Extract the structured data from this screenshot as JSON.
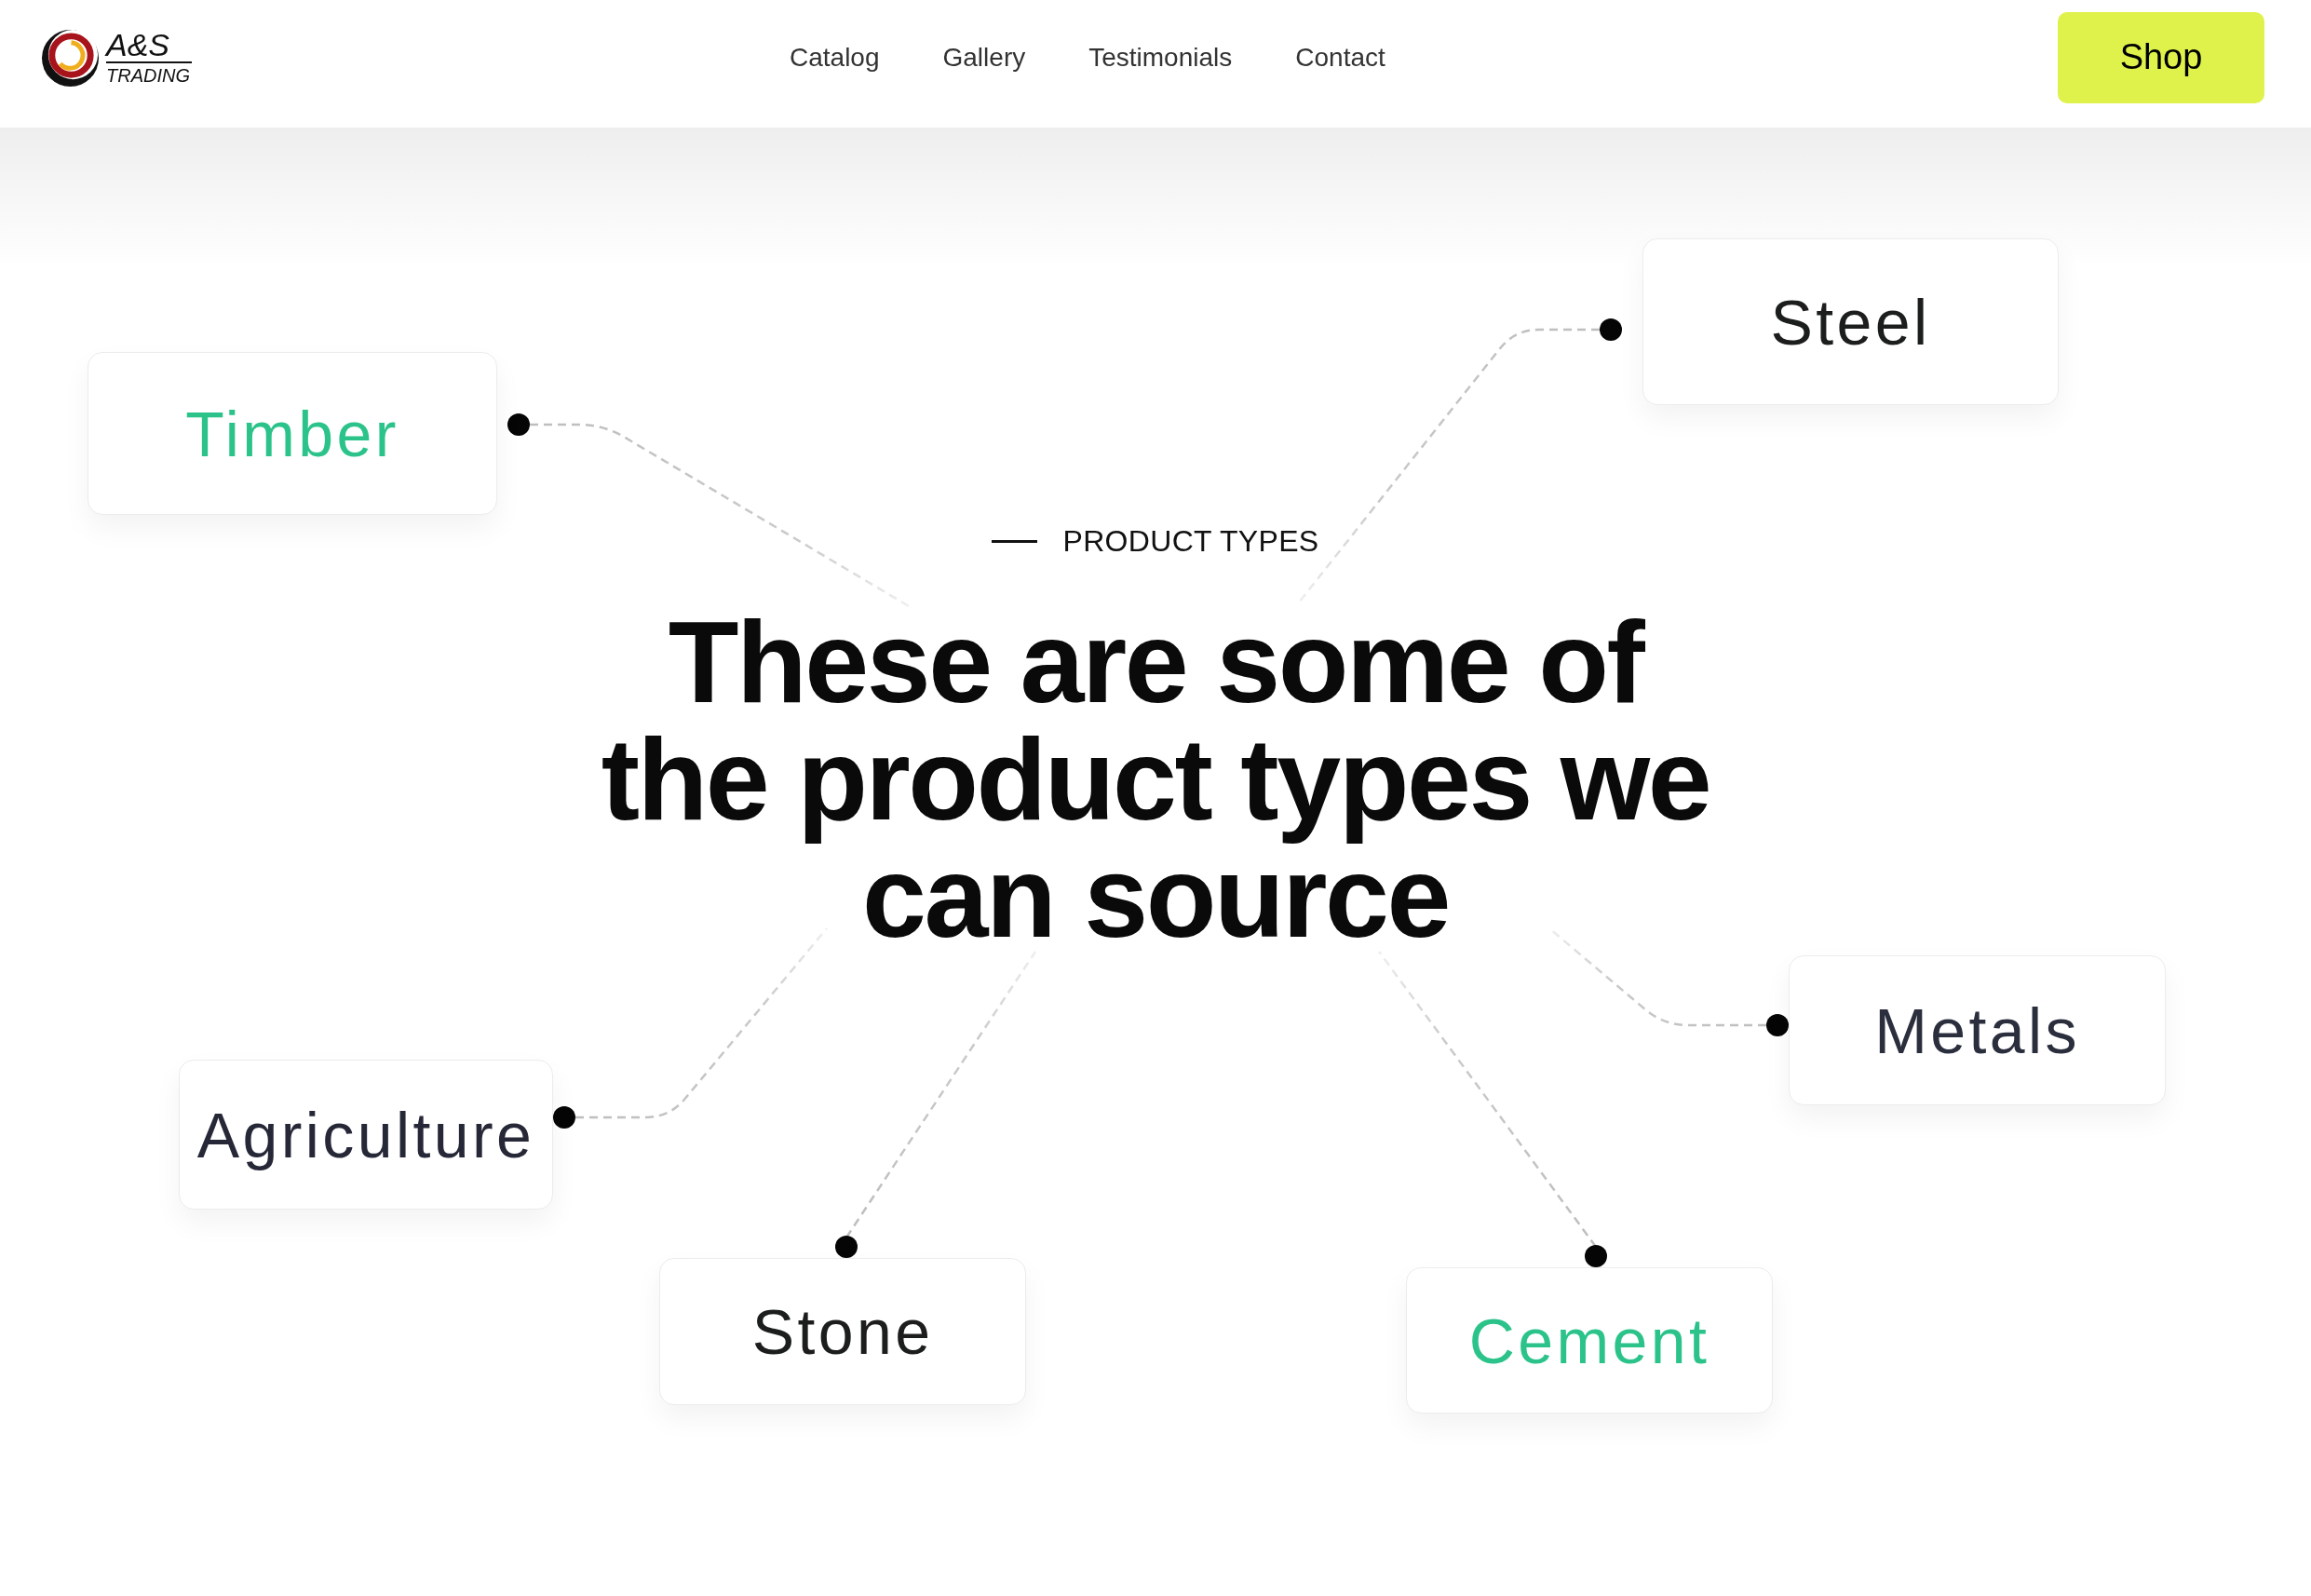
{
  "header": {
    "logo": {
      "name": "A&S",
      "tagline": "TRADING"
    },
    "nav": [
      "Catalog",
      "Gallery",
      "Testimonials",
      "Contact"
    ],
    "shop_button": "Shop"
  },
  "hero": {
    "eyebrow": "PRODUCT TYPES",
    "heading_lines": [
      "These are some of",
      "the product types we",
      "can source"
    ]
  },
  "product_types": [
    {
      "label": "Steel",
      "color": "#1b1e1d"
    },
    {
      "label": "Timber",
      "color": "#2cc38b"
    },
    {
      "label": "Metals",
      "color": "#2b2e3d"
    },
    {
      "label": "Agriculture",
      "color": "#262837"
    },
    {
      "label": "Stone",
      "color": "#1b1e1d"
    },
    {
      "label": "Cement",
      "color": "#2cc38b"
    }
  ]
}
